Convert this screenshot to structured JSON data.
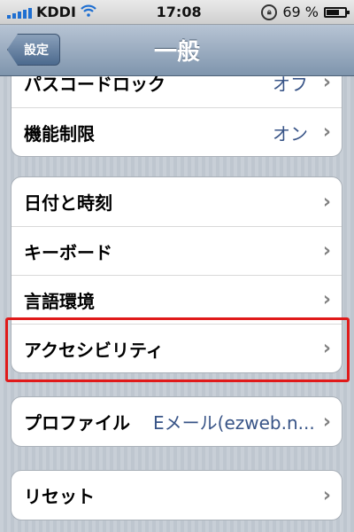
{
  "status_bar": {
    "carrier": "KDDI",
    "time": "17:08",
    "battery_percent_text": "69 %",
    "battery_level": 0.69
  },
  "navbar": {
    "back_label": "設定",
    "title": "一般"
  },
  "groups": [
    {
      "rows": [
        {
          "label": "パスコードロック",
          "value": "オフ"
        },
        {
          "label": "機能制限",
          "value": "オン"
        }
      ]
    },
    {
      "rows": [
        {
          "label": "日付と時刻"
        },
        {
          "label": "キーボード"
        },
        {
          "label": "言語環境"
        },
        {
          "label": "アクセシビリティ"
        }
      ]
    },
    {
      "rows": [
        {
          "label": "プロファイル",
          "value": "Eメール(ezweb.n..."
        }
      ]
    },
    {
      "rows": [
        {
          "label": "リセット"
        }
      ]
    }
  ],
  "chevron": "›",
  "colors": {
    "highlight": "#e01a1a",
    "value_text": "#385487"
  }
}
